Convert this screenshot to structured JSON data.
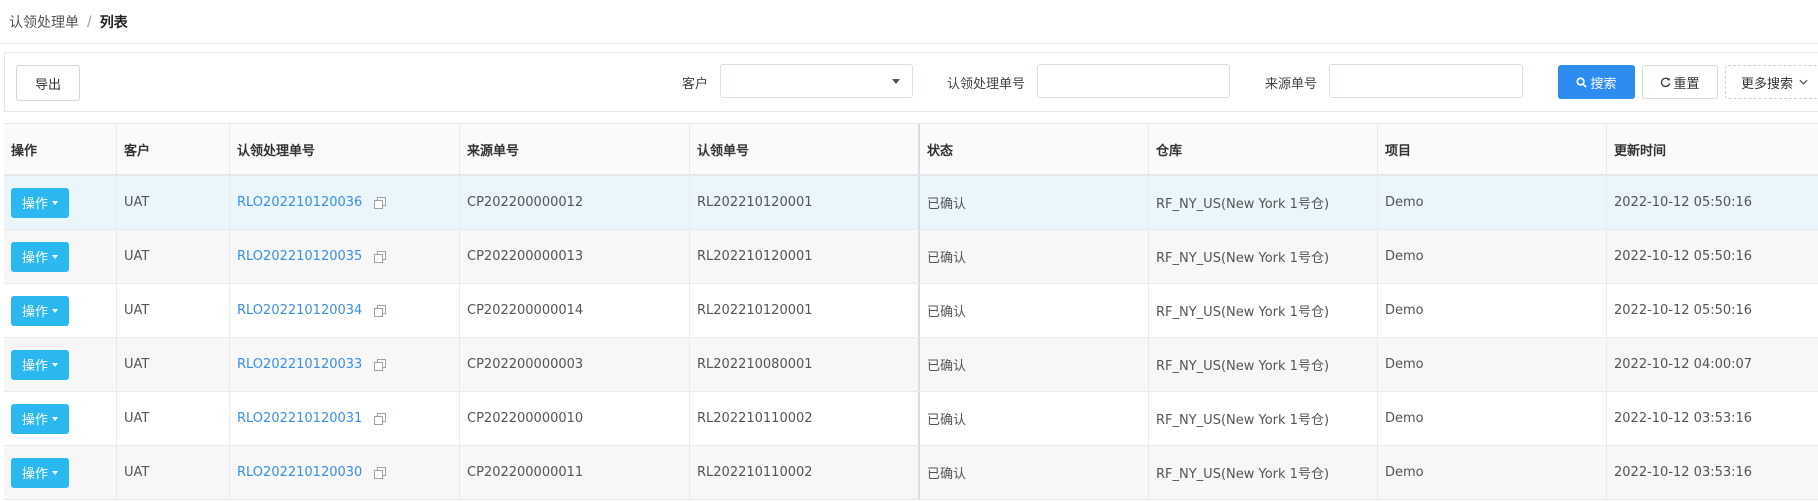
{
  "breadcrumb": {
    "parent": "认领处理单",
    "separator": "/",
    "current": "列表"
  },
  "filters": {
    "export_label": "导出",
    "customer_label": "客户",
    "customer_value": "",
    "claim_order_label": "认领处理单号",
    "claim_order_value": "",
    "source_order_label": "来源单号",
    "source_order_value": "",
    "search_label": "搜索",
    "reset_label": "重置",
    "more_label": "更多搜索"
  },
  "table": {
    "columns": [
      "操作",
      "客户",
      "认领处理单号",
      "来源单号",
      "认领单号",
      "状态",
      "仓库",
      "项目",
      "更新时间"
    ],
    "op_label": "操作",
    "rows": [
      {
        "customer": "UAT",
        "claim_no": "RLO202210120036",
        "source_no": "CP202200000012",
        "claim_ref": "RL202210120001",
        "status": "已确认",
        "warehouse": "RF_NY_US(New York 1号仓)",
        "project": "Demo",
        "updated": "2022-10-12 05:50:16"
      },
      {
        "customer": "UAT",
        "claim_no": "RLO202210120035",
        "source_no": "CP202200000013",
        "claim_ref": "RL202210120001",
        "status": "已确认",
        "warehouse": "RF_NY_US(New York 1号仓)",
        "project": "Demo",
        "updated": "2022-10-12 05:50:16"
      },
      {
        "customer": "UAT",
        "claim_no": "RLO202210120034",
        "source_no": "CP202200000014",
        "claim_ref": "RL202210120001",
        "status": "已确认",
        "warehouse": "RF_NY_US(New York 1号仓)",
        "project": "Demo",
        "updated": "2022-10-12 05:50:16"
      },
      {
        "customer": "UAT",
        "claim_no": "RLO202210120033",
        "source_no": "CP202200000003",
        "claim_ref": "RL202210080001",
        "status": "已确认",
        "warehouse": "RF_NY_US(New York 1号仓)",
        "project": "Demo",
        "updated": "2022-10-12 04:00:07"
      },
      {
        "customer": "UAT",
        "claim_no": "RLO202210120031",
        "source_no": "CP202200000010",
        "claim_ref": "RL202210110002",
        "status": "已确认",
        "warehouse": "RF_NY_US(New York 1号仓)",
        "project": "Demo",
        "updated": "2022-10-12 03:53:16"
      },
      {
        "customer": "UAT",
        "claim_no": "RLO202210120030",
        "source_no": "CP202200000011",
        "claim_ref": "RL202210110002",
        "status": "已确认",
        "warehouse": "RF_NY_US(New York 1号仓)",
        "project": "Demo",
        "updated": "2022-10-12 03:53:16"
      }
    ]
  },
  "colors": {
    "primary": "#2d8cf0",
    "op_button": "#2bb7ef",
    "link": "#3b8ee6",
    "row_highlight": "#eaf6fc"
  }
}
